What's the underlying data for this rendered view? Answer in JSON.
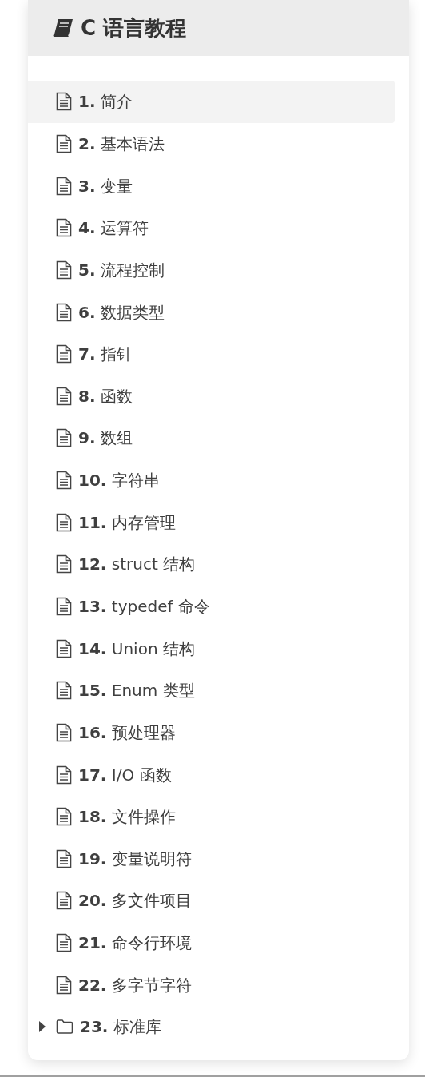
{
  "header": {
    "title": "C 语言教程"
  },
  "items": [
    {
      "kind": "page",
      "number": "1.",
      "label": "简介",
      "selected": true
    },
    {
      "kind": "page",
      "number": "2.",
      "label": "基本语法",
      "selected": false
    },
    {
      "kind": "page",
      "number": "3.",
      "label": "变量",
      "selected": false
    },
    {
      "kind": "page",
      "number": "4.",
      "label": "运算符",
      "selected": false
    },
    {
      "kind": "page",
      "number": "5.",
      "label": "流程控制",
      "selected": false
    },
    {
      "kind": "page",
      "number": "6.",
      "label": "数据类型",
      "selected": false
    },
    {
      "kind": "page",
      "number": "7.",
      "label": "指针",
      "selected": false
    },
    {
      "kind": "page",
      "number": "8.",
      "label": "函数",
      "selected": false
    },
    {
      "kind": "page",
      "number": "9.",
      "label": "数组",
      "selected": false
    },
    {
      "kind": "page",
      "number": "10.",
      "label": "字符串",
      "selected": false
    },
    {
      "kind": "page",
      "number": "11.",
      "label": "内存管理",
      "selected": false
    },
    {
      "kind": "page",
      "number": "12.",
      "label": "struct 结构",
      "selected": false
    },
    {
      "kind": "page",
      "number": "13.",
      "label": "typedef 命令",
      "selected": false
    },
    {
      "kind": "page",
      "number": "14.",
      "label": "Union 结构",
      "selected": false
    },
    {
      "kind": "page",
      "number": "15.",
      "label": "Enum 类型",
      "selected": false
    },
    {
      "kind": "page",
      "number": "16.",
      "label": "预处理器",
      "selected": false
    },
    {
      "kind": "page",
      "number": "17.",
      "label": "I/O 函数",
      "selected": false
    },
    {
      "kind": "page",
      "number": "18.",
      "label": "文件操作",
      "selected": false
    },
    {
      "kind": "page",
      "number": "19.",
      "label": "变量说明符",
      "selected": false
    },
    {
      "kind": "page",
      "number": "20.",
      "label": "多文件项目",
      "selected": false
    },
    {
      "kind": "page",
      "number": "21.",
      "label": "命令行环境",
      "selected": false
    },
    {
      "kind": "page",
      "number": "22.",
      "label": "多字节字符",
      "selected": false
    },
    {
      "kind": "folder",
      "number": "23.",
      "label": "标准库",
      "selected": false,
      "expanded": false
    }
  ]
}
